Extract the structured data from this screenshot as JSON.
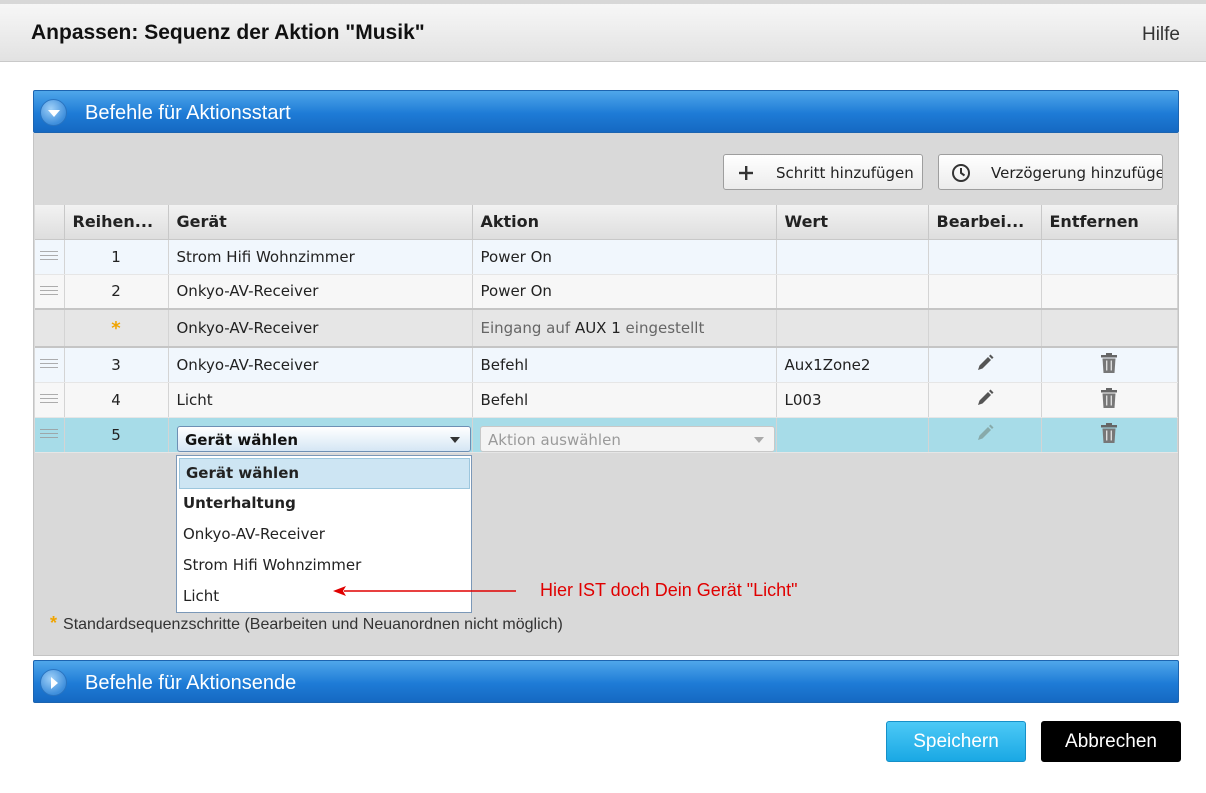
{
  "dialog": {
    "title": "Anpassen: Sequenz der Aktion \"Musik\"",
    "help_label": "Hilfe"
  },
  "panels": {
    "start": {
      "label": "Befehle für Aktionsstart",
      "icon": "chevron-down-icon"
    },
    "end": {
      "label": "Befehle für Aktionsende",
      "icon": "chevron-right-icon"
    }
  },
  "toolbar": {
    "add_step_label": "Schritt hinzufügen",
    "add_step_icon": "plus-icon",
    "add_delay_label": "Verzögerung hinzufügen",
    "add_delay_icon": "clock-icon"
  },
  "table": {
    "columns": [
      "Reihen...",
      "Gerät",
      "Aktion",
      "Wert",
      "Bearbei...",
      "Entfernen"
    ],
    "rows": [
      {
        "order": "1",
        "device": "Strom Hifi Wohnzimmer",
        "action": "Power On",
        "value": ""
      },
      {
        "order": "2",
        "device": "Onkyo-AV-Receiver",
        "action": "Power On",
        "value": ""
      },
      {
        "order": "*",
        "device": "Onkyo-AV-Receiver",
        "action_prefix": "Eingang auf",
        "action_highlight": "AUX 1",
        "action_suffix": "eingestellt",
        "value": ""
      },
      {
        "order": "3",
        "device": "Onkyo-AV-Receiver",
        "action": "Befehl",
        "value": "Aux1Zone2"
      },
      {
        "order": "4",
        "device": "Licht",
        "action": "Befehl",
        "value": "L003"
      },
      {
        "order": "5",
        "device_select": "Gerät wählen",
        "action_select": "Aktion auswählen",
        "value": ""
      }
    ]
  },
  "dropdown": {
    "options": [
      "Gerät wählen",
      "Unterhaltung",
      "Onkyo-AV-Receiver",
      "Strom Hifi Wohnzimmer",
      "Licht"
    ],
    "selected": "Gerät wählen"
  },
  "annotation": {
    "text": "Hier IST doch Dein Gerät \"Licht\"",
    "color": "#e00000"
  },
  "footnote": {
    "marker": "*",
    "text": "Standardsequenzschritte (Bearbeiten und Neuanordnen nicht möglich)"
  },
  "actions": {
    "save_label": "Speichern",
    "cancel_label": "Abbrechen"
  },
  "colors": {
    "panel_header": "#1e7bd6",
    "save_button": "#1aa8e4",
    "selected_row": "#a7dce8",
    "star": "#f0a400"
  }
}
